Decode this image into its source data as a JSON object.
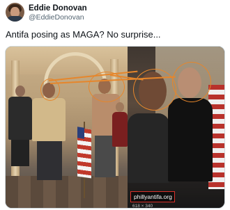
{
  "tweet": {
    "author": {
      "display_name": "Eddie Donovan",
      "handle": "@EddieDonovan",
      "avatar_icon": "profile-photo"
    },
    "text": "Antifa posing as MAGA? No surprise...",
    "media": {
      "left_photo": "capitol-rotunda-group-photo",
      "right_photo": "two-men-close-up-photo",
      "overlay": {
        "source_url": "phillyantifa.org",
        "dimensions_label": "618 × 340",
        "highlight_color": "#e6862b",
        "caption_border_color": "#d9322b"
      }
    }
  }
}
